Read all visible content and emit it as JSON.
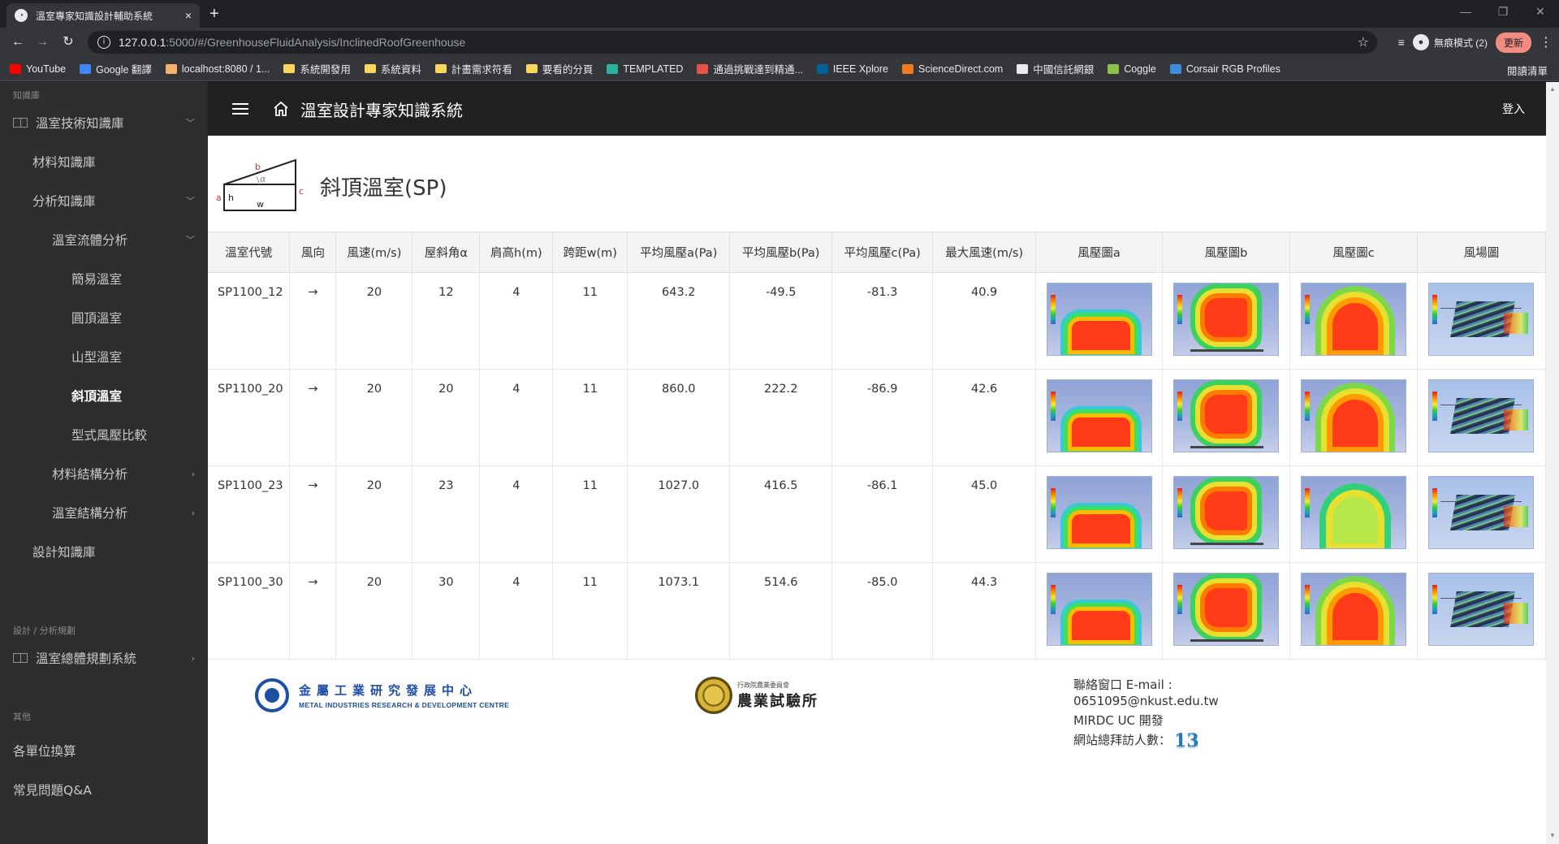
{
  "browser": {
    "tab_title": "溫室專家知識設計輔助系統",
    "tab_close": "×",
    "new_tab": "+",
    "url_host": "127.0.0.1",
    "url_path": ":5000/#/GreenhouseFluidAnalysis/InclinedRoofGreenhouse",
    "profile_label": "無痕模式 (2)",
    "update_label": "更新",
    "reading_list": "閱讀清單",
    "bookmarks": [
      {
        "label": "YouTube",
        "color": "#ff0000"
      },
      {
        "label": "Google 翻譯",
        "color": "#4285f4"
      },
      {
        "label": "localhost:8080 / 1...",
        "color": "#f6b26b"
      },
      {
        "label": "系統開發用",
        "color": "folder"
      },
      {
        "label": "系統資料",
        "color": "folder"
      },
      {
        "label": "計畫需求符看",
        "color": "folder"
      },
      {
        "label": "要看的分頁",
        "color": "folder"
      },
      {
        "label": "TEMPLATED",
        "color": "#2bb3a0"
      },
      {
        "label": "通過挑戰達到精通...",
        "color": "#e5534b"
      },
      {
        "label": "IEEE Xplore",
        "color": "#00629b"
      },
      {
        "label": "ScienceDirect.com",
        "color": "#f47a20"
      },
      {
        "label": "中國信託網銀",
        "color": "#e8eaed"
      },
      {
        "label": "Coggle",
        "color": "#8bc34a"
      },
      {
        "label": "Corsair RGB Profiles",
        "color": "#3c8dde"
      }
    ]
  },
  "sidebar": {
    "section_knowledge": "知識庫",
    "section_design": "設計 / 分析規劃",
    "section_other": "其他",
    "items": [
      {
        "label": "溫室技術知識庫"
      },
      {
        "label": "材料知識庫"
      },
      {
        "label": "分析知識庫"
      },
      {
        "label": "溫室流體分析"
      },
      {
        "label": "簡易溫室"
      },
      {
        "label": "圓頂溫室"
      },
      {
        "label": "山型溫室"
      },
      {
        "label": "斜頂溫室"
      },
      {
        "label": "型式風壓比較"
      },
      {
        "label": "材料結構分析"
      },
      {
        "label": "溫室結構分析"
      },
      {
        "label": "設計知識庫"
      },
      {
        "label": "溫室總體規劃系統"
      },
      {
        "label": "各單位換算"
      },
      {
        "label": "常見問題Q&A"
      }
    ]
  },
  "appbar": {
    "title": "溫室設計專家知識系統",
    "login": "登入"
  },
  "page": {
    "title": "斜頂溫室(SP)",
    "diagram_labels": {
      "a": "a",
      "b": "b",
      "c": "c",
      "h": "h",
      "w": "w",
      "alpha": "α"
    }
  },
  "table": {
    "headers": [
      "溫室代號",
      "風向",
      "風速(m/s)",
      "屋斜角α",
      "肩高h(m)",
      "跨距w(m)",
      "平均風壓a(Pa)",
      "平均風壓b(Pa)",
      "平均風壓c(Pa)",
      "最大風速(m/s)",
      "風壓圖a",
      "風壓圖b",
      "風壓圖c",
      "風場圖"
    ],
    "rows": [
      {
        "code": "SP1100_12",
        "dir": "→",
        "speed": "20",
        "angle": "12",
        "h": "4",
        "w": "11",
        "pa": "643.2",
        "pb": "-49.5",
        "pc": "-81.3",
        "vmax": "40.9"
      },
      {
        "code": "SP1100_20",
        "dir": "→",
        "speed": "20",
        "angle": "20",
        "h": "4",
        "w": "11",
        "pa": "860.0",
        "pb": "222.2",
        "pc": "-86.9",
        "vmax": "42.6"
      },
      {
        "code": "SP1100_23",
        "dir": "→",
        "speed": "20",
        "angle": "23",
        "h": "4",
        "w": "11",
        "pa": "1027.0",
        "pb": "416.5",
        "pc": "-86.1",
        "vmax": "45.0"
      },
      {
        "code": "SP1100_30",
        "dir": "→",
        "speed": "20",
        "angle": "30",
        "h": "4",
        "w": "11",
        "pa": "1073.1",
        "pb": "514.6",
        "pc": "-85.0",
        "vmax": "44.3"
      }
    ]
  },
  "footer": {
    "logo1_zh": "金屬工業研究發展中心",
    "logo1_en": "METAL INDUSTRIES RESEARCH & DEVELOPMENT CENTRE",
    "logo2_small": "行政院農業委員會",
    "logo2_big": "農業試驗所",
    "contact_label": "聯絡窗口 E-mail :",
    "contact_email": "0651095@nkust.edu.tw",
    "developer": "MIRDC UC 開發",
    "visits_label": "網站總拜訪人數：",
    "visits_count": "13"
  }
}
